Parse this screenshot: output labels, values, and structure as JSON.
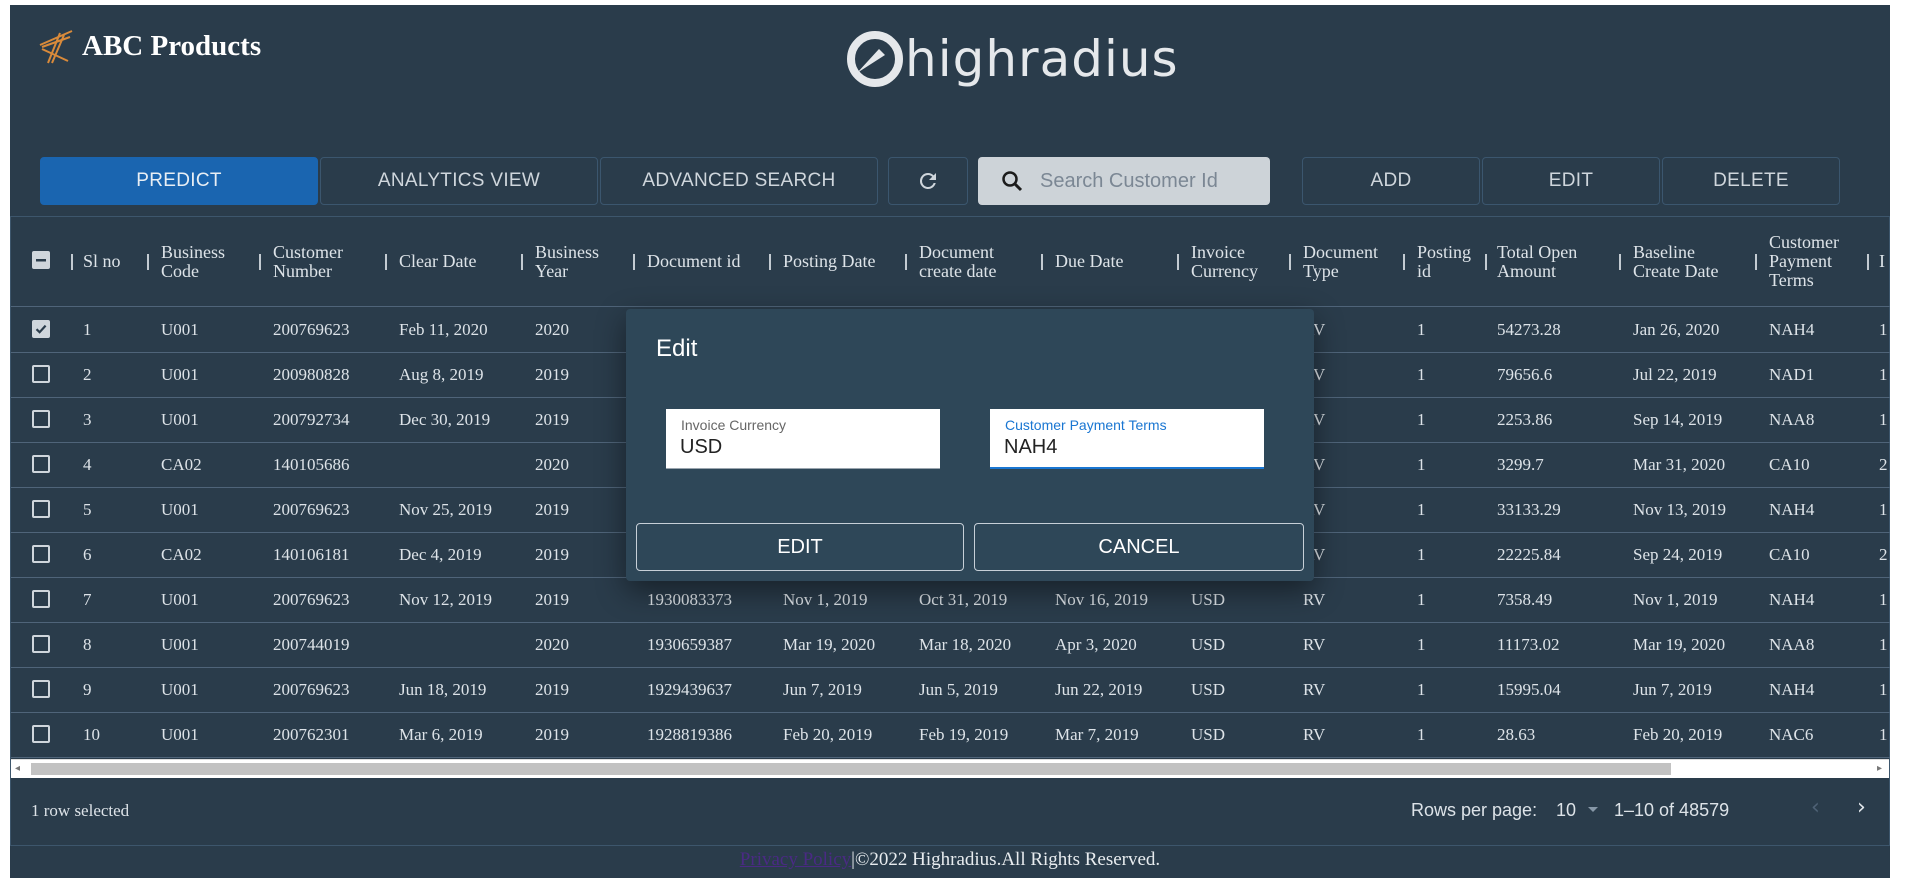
{
  "header": {
    "brand_name": "ABC Products",
    "center_logo_text": "highradius"
  },
  "toolbar": {
    "predict": "PREDICT",
    "analytics": "ANALYTICS VIEW",
    "advanced_search": "ADVANCED SEARCH",
    "refresh_icon": "refresh-icon",
    "search_placeholder": "Search Customer Id",
    "add": "ADD",
    "edit": "EDIT",
    "delete": "DELETE"
  },
  "table": {
    "headers": {
      "sl_no": "Sl no",
      "business_code": "Business Code",
      "customer_number": "Customer Number",
      "clear_date": "Clear Date",
      "business_year": "Business Year",
      "document_id": "Document id",
      "posting_date": "Posting Date",
      "document_create_date": "Document create date",
      "due_date": "Due Date",
      "invoice_currency": "Invoice Currency",
      "document_type": "Document Type",
      "posting_id": "Posting id",
      "total_open_amount": "Total Open Amount",
      "baseline_create_date": "Baseline Create Date",
      "customer_payment_terms": "Customer Payment Terms",
      "next_col": "I"
    },
    "rows": [
      {
        "sl": "1",
        "bc": "U001",
        "cn": "200769623",
        "cd": "Feb 11, 2020",
        "by": "2020",
        "di": "",
        "pd": "",
        "dcd": "",
        "dd": "",
        "ic": "",
        "dt": "RV",
        "pi": "1",
        "toa": "54273.28",
        "bcd": "Jan 26, 2020",
        "cpt": "NAH4",
        "nx": "1",
        "checked": true
      },
      {
        "sl": "2",
        "bc": "U001",
        "cn": "200980828",
        "cd": "Aug 8, 2019",
        "by": "2019",
        "di": "",
        "pd": "",
        "dcd": "",
        "dd": "",
        "ic": "",
        "dt": "RV",
        "pi": "1",
        "toa": "79656.6",
        "bcd": "Jul 22, 2019",
        "cpt": "NAD1",
        "nx": "1",
        "checked": false
      },
      {
        "sl": "3",
        "bc": "U001",
        "cn": "200792734",
        "cd": "Dec 30, 2019",
        "by": "2019",
        "di": "",
        "pd": "",
        "dcd": "",
        "dd": "",
        "ic": "",
        "dt": "RV",
        "pi": "1",
        "toa": "2253.86",
        "bcd": "Sep 14, 2019",
        "cpt": "NAA8",
        "nx": "1",
        "checked": false
      },
      {
        "sl": "4",
        "bc": "CA02",
        "cn": "140105686",
        "cd": "",
        "by": "2020",
        "di": "",
        "pd": "",
        "dcd": "",
        "dd": "",
        "ic": "",
        "dt": "RV",
        "pi": "1",
        "toa": "3299.7",
        "bcd": "Mar 31, 2020",
        "cpt": "CA10",
        "nx": "2",
        "checked": false
      },
      {
        "sl": "5",
        "bc": "U001",
        "cn": "200769623",
        "cd": "Nov 25, 2019",
        "by": "2019",
        "di": "",
        "pd": "",
        "dcd": "",
        "dd": "",
        "ic": "",
        "dt": "RV",
        "pi": "1",
        "toa": "33133.29",
        "bcd": "Nov 13, 2019",
        "cpt": "NAH4",
        "nx": "1",
        "checked": false
      },
      {
        "sl": "6",
        "bc": "CA02",
        "cn": "140106181",
        "cd": "Dec 4, 2019",
        "by": "2019",
        "di": "",
        "pd": "",
        "dcd": "",
        "dd": "",
        "ic": "",
        "dt": "RV",
        "pi": "1",
        "toa": "22225.84",
        "bcd": "Sep 24, 2019",
        "cpt": "CA10",
        "nx": "2",
        "checked": false
      },
      {
        "sl": "7",
        "bc": "U001",
        "cn": "200769623",
        "cd": "Nov 12, 2019",
        "by": "2019",
        "di": "1930083373",
        "pd": "Nov 1, 2019",
        "dcd": "Oct 31, 2019",
        "dd": "Nov 16, 2019",
        "ic": "USD",
        "dt": "RV",
        "pi": "1",
        "toa": "7358.49",
        "bcd": "Nov 1, 2019",
        "cpt": "NAH4",
        "nx": "1",
        "checked": false
      },
      {
        "sl": "8",
        "bc": "U001",
        "cn": "200744019",
        "cd": "",
        "by": "2020",
        "di": "1930659387",
        "pd": "Mar 19, 2020",
        "dcd": "Mar 18, 2020",
        "dd": "Apr 3, 2020",
        "ic": "USD",
        "dt": "RV",
        "pi": "1",
        "toa": "11173.02",
        "bcd": "Mar 19, 2020",
        "cpt": "NAA8",
        "nx": "1",
        "checked": false
      },
      {
        "sl": "9",
        "bc": "U001",
        "cn": "200769623",
        "cd": "Jun 18, 2019",
        "by": "2019",
        "di": "1929439637",
        "pd": "Jun 7, 2019",
        "dcd": "Jun 5, 2019",
        "dd": "Jun 22, 2019",
        "ic": "USD",
        "dt": "RV",
        "pi": "1",
        "toa": "15995.04",
        "bcd": "Jun 7, 2019",
        "cpt": "NAH4",
        "nx": "1",
        "checked": false
      },
      {
        "sl": "10",
        "bc": "U001",
        "cn": "200762301",
        "cd": "Mar 6, 2019",
        "by": "2019",
        "di": "1928819386",
        "pd": "Feb 20, 2019",
        "dcd": "Feb 19, 2019",
        "dd": "Mar 7, 2019",
        "ic": "USD",
        "dt": "RV",
        "pi": "1",
        "toa": "28.63",
        "bcd": "Feb 20, 2019",
        "cpt": "NAC6",
        "nx": "1",
        "checked": false
      }
    ]
  },
  "pagination": {
    "selected_text": "1 row selected",
    "rows_per_page_label": "Rows per page:",
    "rows_per_page_value": "10",
    "range_text": "1–10 of 48579"
  },
  "footer": {
    "privacy_link": "Privacy Policy",
    "copyright": "|©2022 Highradius.All Rights Reserved."
  },
  "dialog": {
    "title": "Edit",
    "invoice_currency_label": "Invoice Currency",
    "invoice_currency_value": "USD",
    "payment_terms_label": "Customer Payment Terms",
    "payment_terms_value": "NAH4",
    "edit_button": "EDIT",
    "cancel_button": "CANCEL"
  },
  "colors": {
    "background": "#2a3c4b",
    "accent": "#1a65b0",
    "dialog": "#2e4758"
  }
}
